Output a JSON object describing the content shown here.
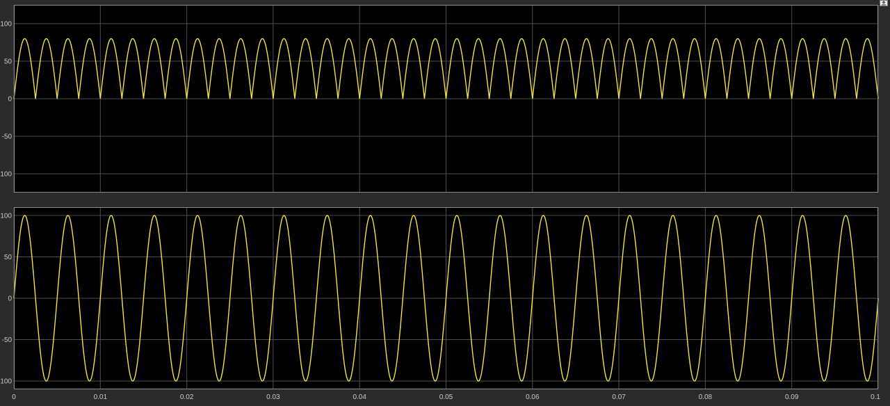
{
  "colors": {
    "figure_bg": "#2b2b2b",
    "axes_bg": "#000000",
    "grid": "#4d4d4d",
    "axes_border": "#8c8c8c",
    "tick_text": "#c8c8c8",
    "trace": "#f2e14a"
  },
  "toolbar": {
    "undock_icon": "undock-arrow-icon"
  },
  "chart_data": [
    {
      "type": "line",
      "title": "",
      "xlabel": "",
      "ylabel": "",
      "xlim": [
        0,
        0.1
      ],
      "ylim": [
        -125,
        125
      ],
      "grid": true,
      "xticks": [
        0,
        0.01,
        0.02,
        0.03,
        0.04,
        0.05,
        0.06,
        0.07,
        0.08,
        0.09,
        0.1
      ],
      "xtick_labels": [],
      "yticks": [
        100,
        50,
        0,
        -50,
        -100
      ],
      "ytick_labels": [
        "100",
        "50",
        "0",
        "-50",
        "-100"
      ],
      "series": [
        {
          "function": "abs(sin)",
          "amplitude": 80,
          "frequency_hz": 200,
          "x_start": 0,
          "x_end": 0.1
        }
      ]
    },
    {
      "type": "line",
      "title": "",
      "xlabel": "",
      "ylabel": "",
      "xlim": [
        0,
        0.1
      ],
      "ylim": [
        -110,
        110
      ],
      "grid": true,
      "xticks": [
        0,
        0.01,
        0.02,
        0.03,
        0.04,
        0.05,
        0.06,
        0.07,
        0.08,
        0.09,
        0.1
      ],
      "xtick_labels": [
        "0",
        "0.01",
        "0.02",
        "0.03",
        "0.04",
        "0.05",
        "0.06",
        "0.07",
        "0.08",
        "0.09",
        "0.1"
      ],
      "yticks": [
        100,
        50,
        0,
        -50,
        -100
      ],
      "ytick_labels": [
        "100",
        "50",
        "0",
        "-50",
        "-100"
      ],
      "series": [
        {
          "function": "sin",
          "amplitude": 100,
          "frequency_hz": 200,
          "x_start": 0,
          "x_end": 0.1
        }
      ]
    }
  ]
}
